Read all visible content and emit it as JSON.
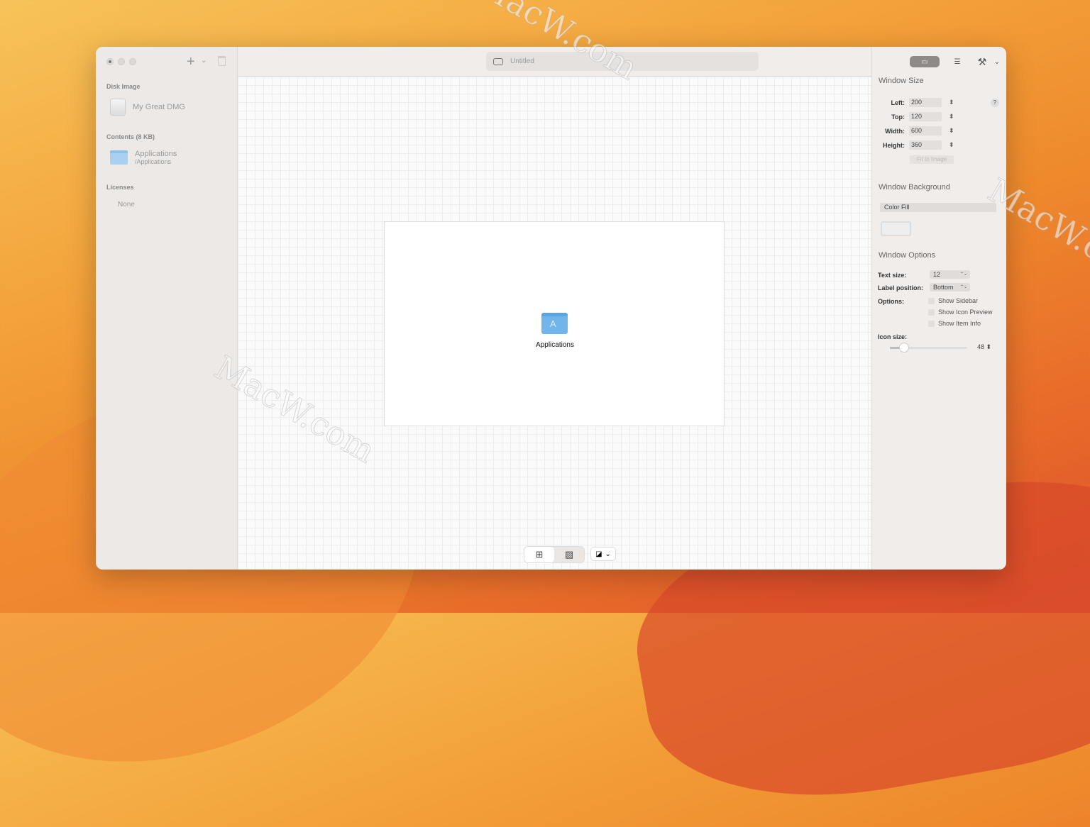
{
  "watermark": "MacW.com",
  "sidebar": {
    "disk_image_header": "Disk Image",
    "disk_name": "My Great DMG",
    "contents_header": "Contents (8 KB)",
    "content_item": {
      "name": "Applications",
      "path": "/Applications"
    },
    "licenses_header": "Licenses",
    "licenses_value": "None"
  },
  "toolbar": {
    "add": "+",
    "add_chevron": "⌄",
    "title": "Untitled"
  },
  "canvas": {
    "item_label": "Applications",
    "item_glyph": "A"
  },
  "bottom": {
    "grid": "⊞",
    "image": "▨",
    "color": "◪",
    "chevron": "⌄"
  },
  "inspector": {
    "tabs": [
      "▭",
      "☰",
      "⚒",
      "⌄"
    ],
    "window_size": {
      "title": "Window Size",
      "left_label": "Left:",
      "left": "200",
      "top_label": "Top:",
      "top": "120",
      "width_label": "Width:",
      "width": "600",
      "height_label": "Height:",
      "height": "360",
      "help": "?",
      "fit": "Fit to Image",
      "stepper": "⬍"
    },
    "background": {
      "title": "Window Background",
      "mode": "Color Fill"
    },
    "options": {
      "title": "Window Options",
      "text_size_label": "Text size:",
      "text_size": "12",
      "label_pos_label": "Label position:",
      "label_pos": "Bottom",
      "options_label": "Options:",
      "show_sidebar": "Show Sidebar",
      "show_icon_preview": "Show Icon Preview",
      "show_item_info": "Show Item Info",
      "icon_size_label": "Icon size:",
      "icon_size": "48"
    }
  }
}
